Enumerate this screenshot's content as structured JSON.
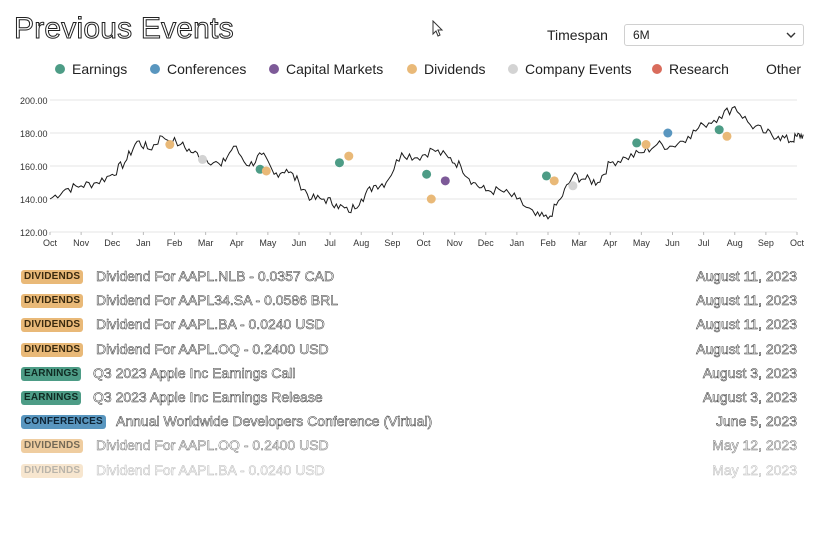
{
  "header": {
    "title": "Previous Events",
    "timespan_label": "Timespan",
    "timespan_value": "6M"
  },
  "legend": {
    "items": [
      {
        "label": "Earnings",
        "color": "#4d9c86"
      },
      {
        "label": "Conferences",
        "color": "#5996bf"
      },
      {
        "label": "Capital Markets",
        "color": "#7d5a98"
      },
      {
        "label": "Dividends",
        "color": "#e9b978"
      },
      {
        "label": "Company Events",
        "color": "#d3d3d3"
      },
      {
        "label": "Research",
        "color": "#d96c5c"
      },
      {
        "label": "Other",
        "color": ""
      }
    ]
  },
  "chart_data": {
    "type": "line",
    "y_ticks": [
      "200.00",
      "180.00",
      "160.00",
      "140.00",
      "120.00"
    ],
    "ylim": [
      120,
      200
    ],
    "grid": true,
    "x_ticks": [
      "Oct",
      "Nov",
      "Dec",
      "Jan",
      "Feb",
      "Mar",
      "Apr",
      "May",
      "Jun",
      "Jul",
      "Aug",
      "Sep",
      "Oct",
      "Nov",
      "Dec",
      "Jan",
      "Feb",
      "Mar",
      "Apr",
      "May",
      "Jun",
      "Jul",
      "Aug",
      "Sep",
      "Oct"
    ],
    "price_points": [
      [
        0,
        140
      ],
      [
        0.5,
        146
      ],
      [
        1,
        148
      ],
      [
        1.5,
        150
      ],
      [
        2,
        155
      ],
      [
        2.4,
        162
      ],
      [
        2.8,
        175
      ],
      [
        3.2,
        170
      ],
      [
        3.6,
        178
      ],
      [
        4.2,
        173
      ],
      [
        4.6,
        168
      ],
      [
        5,
        165
      ],
      [
        5.5,
        160
      ],
      [
        5.9,
        172
      ],
      [
        6.4,
        160
      ],
      [
        6.8,
        167
      ],
      [
        7.2,
        155
      ],
      [
        7.6,
        158
      ],
      [
        8,
        150
      ],
      [
        8.4,
        140
      ],
      [
        8.8,
        140
      ],
      [
        9.2,
        137
      ],
      [
        9.6,
        132
      ],
      [
        10,
        140
      ],
      [
        10.4,
        148
      ],
      [
        10.8,
        150
      ],
      [
        11.3,
        168
      ],
      [
        11.8,
        165
      ],
      [
        12.3,
        170
      ],
      [
        12.8,
        165
      ],
      [
        13.2,
        160
      ],
      [
        13.6,
        150
      ],
      [
        14,
        145
      ],
      [
        14.5,
        145
      ],
      [
        15,
        140
      ],
      [
        15.6,
        130
      ],
      [
        16,
        128
      ],
      [
        16.4,
        140
      ],
      [
        16.8,
        154
      ],
      [
        17.2,
        152
      ],
      [
        17.6,
        150
      ],
      [
        18,
        162
      ],
      [
        18.5,
        165
      ],
      [
        19,
        168
      ],
      [
        19.5,
        173
      ],
      [
        20,
        172
      ],
      [
        20.5,
        178
      ],
      [
        21,
        185
      ],
      [
        21.5,
        190
      ],
      [
        22,
        196
      ],
      [
        22.5,
        185
      ],
      [
        23,
        180
      ],
      [
        23.4,
        178
      ],
      [
        23.8,
        175
      ],
      [
        24,
        178
      ],
      [
        24.2,
        179
      ]
    ],
    "events": [
      {
        "x": 3.85,
        "y": 173,
        "category": "Dividends"
      },
      {
        "x": 4.9,
        "y": 164,
        "category": "Company Events"
      },
      {
        "x": 6.75,
        "y": 158,
        "category": "Earnings"
      },
      {
        "x": 6.95,
        "y": 157,
        "category": "Dividends"
      },
      {
        "x": 9.3,
        "y": 162,
        "category": "Earnings"
      },
      {
        "x": 9.6,
        "y": 166,
        "category": "Dividends"
      },
      {
        "x": 12.1,
        "y": 155,
        "category": "Earnings"
      },
      {
        "x": 12.25,
        "y": 140,
        "category": "Dividends"
      },
      {
        "x": 12.7,
        "y": 151,
        "category": "Capital Markets"
      },
      {
        "x": 15.95,
        "y": 154,
        "category": "Earnings"
      },
      {
        "x": 16.2,
        "y": 151,
        "category": "Dividends"
      },
      {
        "x": 16.8,
        "y": 148,
        "category": "Company Events"
      },
      {
        "x": 18.85,
        "y": 174,
        "category": "Earnings"
      },
      {
        "x": 19.15,
        "y": 173,
        "category": "Dividends"
      },
      {
        "x": 19.85,
        "y": 180,
        "category": "Conferences"
      },
      {
        "x": 21.5,
        "y": 182,
        "category": "Earnings"
      },
      {
        "x": 21.75,
        "y": 178,
        "category": "Dividends"
      }
    ]
  },
  "events": [
    {
      "badge": "DIVIDENDS",
      "type": "dividends",
      "title": "Dividend For AAPL.NLB - 0.0357 CAD",
      "date": "August 11, 2023"
    },
    {
      "badge": "DIVIDENDS",
      "type": "dividends",
      "title": "Dividend For AAPL34.SA - 0.0586 BRL",
      "date": "August 11, 2023"
    },
    {
      "badge": "DIVIDENDS",
      "type": "dividends",
      "title": "Dividend For AAPL.BA - 0.0240 USD",
      "date": "August 11, 2023"
    },
    {
      "badge": "DIVIDENDS",
      "type": "dividends",
      "title": "Dividend For AAPL.OQ - 0.2400 USD",
      "date": "August 11, 2023"
    },
    {
      "badge": "EARNINGS",
      "type": "earnings",
      "title": "Q3 2023 Apple Inc Earnings Call",
      "date": "August 3, 2023"
    },
    {
      "badge": "EARNINGS",
      "type": "earnings",
      "title": "Q3 2023 Apple Inc Earnings Release",
      "date": "August 3, 2023"
    },
    {
      "badge": "CONFERENCES",
      "type": "conferences",
      "title": "Annual Worldwide Developers Conference (Virtual)",
      "date": "June 5, 2023"
    },
    {
      "badge": "DIVIDENDS",
      "type": "dividends",
      "title": "Dividend For AAPL.OQ - 0.2400 USD",
      "date": "May 12, 2023"
    },
    {
      "badge": "DIVIDENDS",
      "type": "dividends",
      "title": "Dividend For AAPL.BA - 0.0240 USD",
      "date": "May 12, 2023"
    }
  ]
}
